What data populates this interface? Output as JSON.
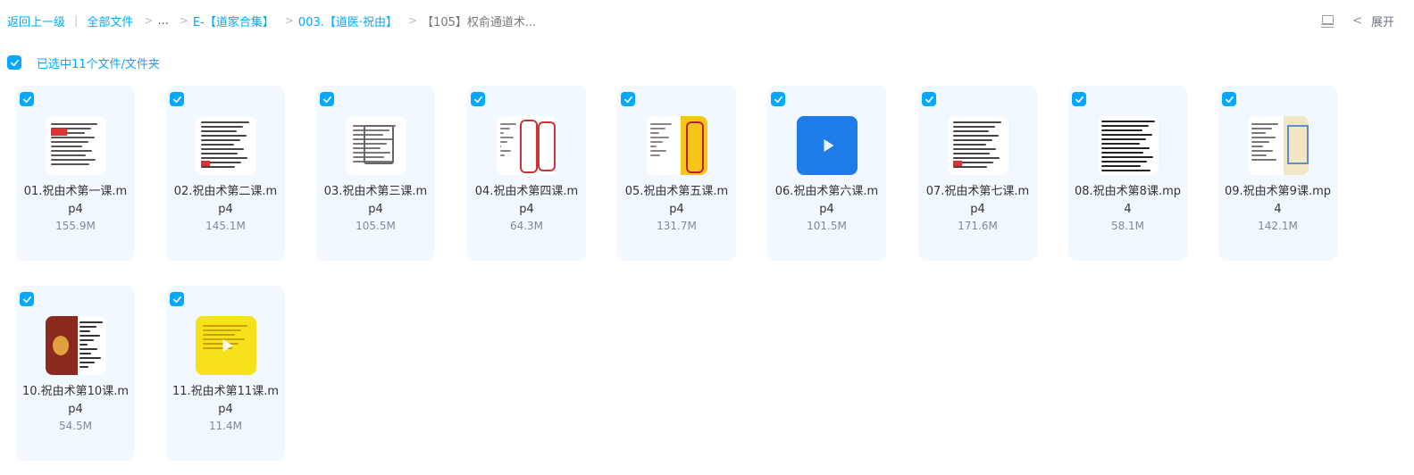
{
  "breadcrumb": {
    "back": "返回上一级",
    "sep": "|",
    "items": [
      "全部文件",
      "...",
      "E-【道家合集】",
      "003.【道医·祝由】"
    ],
    "current": "【105】权俞通道术...",
    "arrow": ">"
  },
  "top_right": {
    "expand_label": "展开",
    "chevron": "<"
  },
  "selection": {
    "label": "已选中11个文件/文件夹"
  },
  "colors": {
    "accent": "#06a7ff",
    "card_bg": "#f2f8ff"
  },
  "files": [
    {
      "name": "01.祝由术第一课.mp4",
      "size": "155.9M",
      "thumb": "doc-red"
    },
    {
      "name": "02.祝由术第二课.mp4",
      "size": "145.1M",
      "thumb": "doc-text"
    },
    {
      "name": "03.祝由术第三课.mp4",
      "size": "105.5M",
      "thumb": "doc-glyph"
    },
    {
      "name": "04.祝由术第四课.mp4",
      "size": "64.3M",
      "thumb": "talisman-red"
    },
    {
      "name": "05.祝由术第五课.mp4",
      "size": "131.7M",
      "thumb": "talisman-yellow"
    },
    {
      "name": "06.祝由术第六课.mp4",
      "size": "101.5M",
      "thumb": "video-blue"
    },
    {
      "name": "07.祝由术第七课.mp4",
      "size": "171.6M",
      "thumb": "doc-text"
    },
    {
      "name": "08.祝由术第8课.mp4",
      "size": "58.1M",
      "thumb": "doc-dense"
    },
    {
      "name": "09.祝由术第9课.mp4",
      "size": "142.1M",
      "thumb": "doc-book"
    },
    {
      "name": "10.祝由术第10课.mp4",
      "size": "54.5M",
      "thumb": "doc-photo"
    },
    {
      "name": "11.祝由术第11课.mp4",
      "size": "11.4M",
      "thumb": "video-yellow"
    }
  ]
}
